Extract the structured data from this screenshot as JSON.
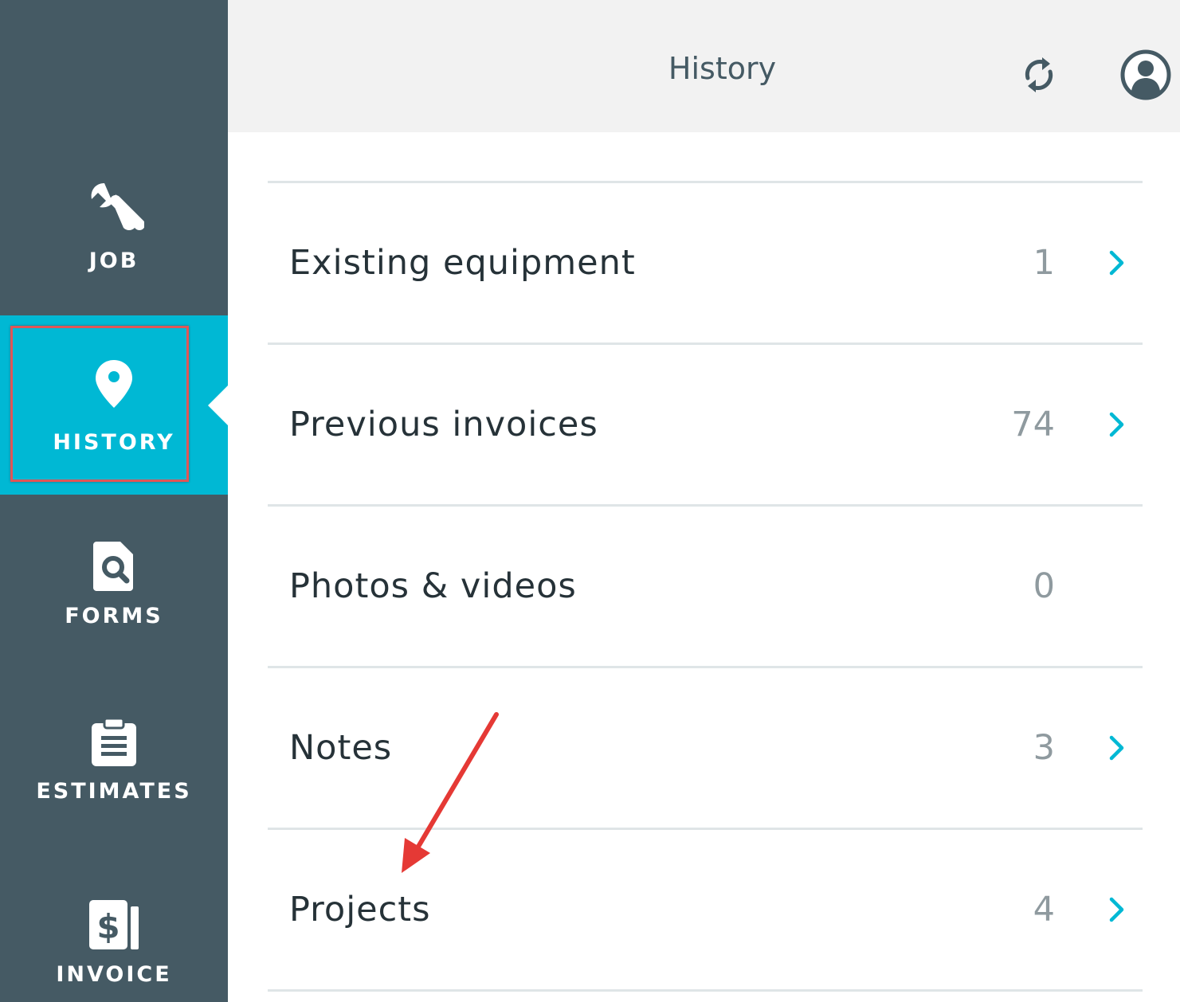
{
  "header": {
    "title": "History"
  },
  "sidebar": {
    "items": [
      {
        "label": "JOB",
        "icon": "wrench-icon"
      },
      {
        "label": "HISTORY",
        "icon": "map-pin-icon",
        "active": true
      },
      {
        "label": "FORMS",
        "icon": "form-search-icon"
      },
      {
        "label": "ESTIMATES",
        "icon": "clipboard-icon"
      },
      {
        "label": "INVOICE",
        "icon": "invoice-dollar-icon"
      }
    ]
  },
  "list": {
    "rows": [
      {
        "label": "Existing equipment",
        "count": "1",
        "has_chevron": true
      },
      {
        "label": "Previous invoices",
        "count": "74",
        "has_chevron": true
      },
      {
        "label": "Photos & videos",
        "count": "0",
        "has_chevron": false
      },
      {
        "label": "Notes",
        "count": "3",
        "has_chevron": true
      },
      {
        "label": "Projects",
        "count": "4",
        "has_chevron": true
      }
    ]
  },
  "colors": {
    "sidebar_bg": "#455a64",
    "active_bg": "#00b8d4",
    "accent": "#00b8d4",
    "annotation": "#e53935",
    "header_bg": "#f2f2f2"
  }
}
